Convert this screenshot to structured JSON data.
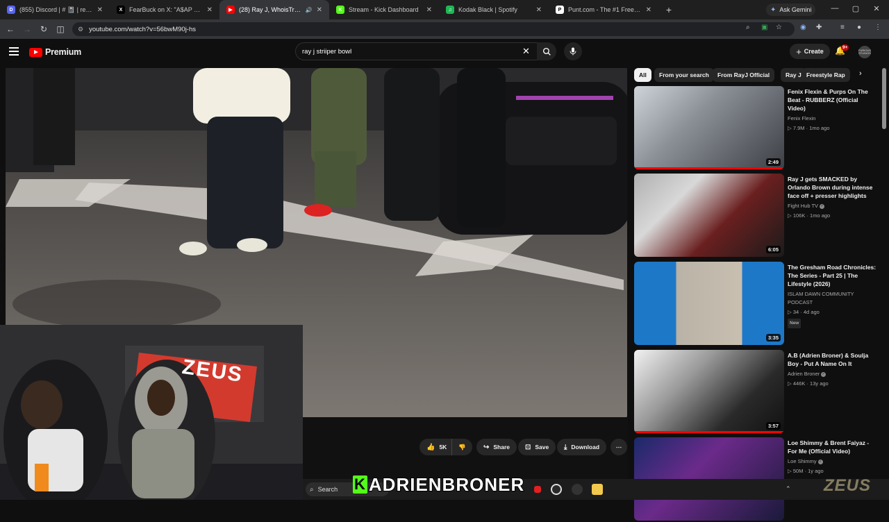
{
  "browser": {
    "tabs": [
      {
        "title": "(855) Discord | # 📓 | reactions",
        "favicon_color": "#5865f2",
        "favicon_text": "D"
      },
      {
        "title": "FearBuck on X: \"A$AP Rocky gi",
        "favicon_color": "#000000",
        "favicon_text": "X"
      },
      {
        "title": "(28) Ray J, WhoisTruth - Stri",
        "favicon_color": "#ff0000",
        "favicon_text": "▶",
        "active": true
      },
      {
        "title": "Stream - Kick Dashboard",
        "favicon_color": "#53fc18",
        "favicon_text": "K"
      },
      {
        "title": "Kodak Black | Spotify",
        "favicon_color": "#1db954",
        "favicon_text": "♫"
      },
      {
        "title": "Punt.com - The #1 Free to Play",
        "favicon_color": "#ffffff",
        "favicon_text": "P"
      }
    ],
    "ask_gemini": "Ask Gemini",
    "url": "youtube.com/watch?v=56bwM90j-hs"
  },
  "youtube": {
    "brand": "Premium",
    "search_query": "ray j striiper bowl",
    "create_label": "Create",
    "notification_count": "9+",
    "avatar_text": "FURIOUS STUDIOS"
  },
  "actions": {
    "likes": "5K",
    "share": "Share",
    "save": "Save",
    "download": "Download"
  },
  "chips": [
    "All",
    "From your search",
    "From RayJ Official",
    "Ray J",
    "Freestyle Rap"
  ],
  "recommendations": [
    {
      "title": "Fenix Flexin & Purps On The Beat - RUBBERZ (Official Video)",
      "channel": "Fenix Flexin",
      "meta": "7.9M · 1mo ago",
      "duration": "2:49",
      "verified": false,
      "badge": "",
      "progress": 1.0
    },
    {
      "title": "Ray J gets SMACKED by Orlando Brown during intense face off + presser highlights",
      "channel": "Fight Hub TV",
      "meta": "106K · 1mo ago",
      "duration": "6:05",
      "verified": true,
      "badge": "",
      "progress": 0
    },
    {
      "title": "The Gresham Road Chronicles: The Series - Part 25 | The Lifestyle (2026)",
      "channel": "ISLAM DAWN COMMUNITY PODCAST",
      "meta": "34 · 4d ago",
      "duration": "3:35",
      "verified": false,
      "badge": "New",
      "progress": 0
    },
    {
      "title": "A.B (Adrien Broner) & Soulja Boy - Put A Name On It",
      "channel": "Adrien Broner",
      "meta": "446K · 13y ago",
      "duration": "3:57",
      "verified": true,
      "badge": "",
      "progress": 1.0
    },
    {
      "title": "Loe Shimmy & Brent Faiyaz - For Me (Official Video)",
      "channel": "Loe Shimmy",
      "meta": "50M · 1y ago",
      "duration": "",
      "verified": true,
      "badge": "",
      "progress": 0
    }
  ],
  "overlay": {
    "streamer_name": "ADRIENBRONER",
    "kick_letter": "K",
    "zeus_logo": "ZEUS",
    "taskbar_search": "Search",
    "webcam_banner": "ZEUS"
  }
}
